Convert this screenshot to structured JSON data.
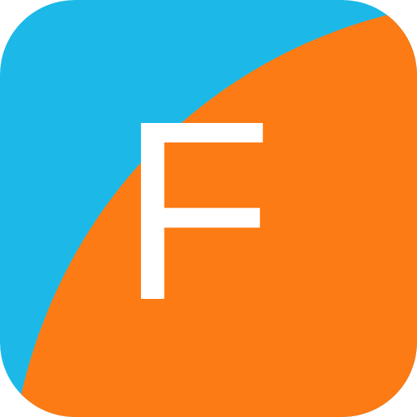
{
  "app_icon": {
    "letter": "F",
    "colors": {
      "background_blue": "#1CB9E8",
      "foreground_orange": "#FD7B14",
      "letter_white": "#FFFFFF"
    }
  }
}
